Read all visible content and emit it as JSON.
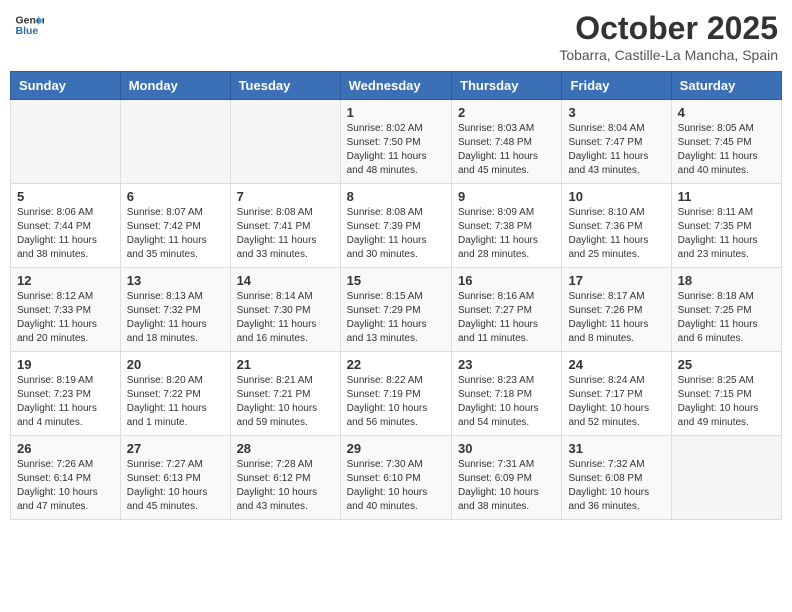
{
  "header": {
    "logo_general": "General",
    "logo_blue": "Blue",
    "month": "October 2025",
    "location": "Tobarra, Castille-La Mancha, Spain"
  },
  "weekdays": [
    "Sunday",
    "Monday",
    "Tuesday",
    "Wednesday",
    "Thursday",
    "Friday",
    "Saturday"
  ],
  "weeks": [
    [
      {
        "day": "",
        "sunrise": "",
        "sunset": "",
        "daylight": ""
      },
      {
        "day": "",
        "sunrise": "",
        "sunset": "",
        "daylight": ""
      },
      {
        "day": "",
        "sunrise": "",
        "sunset": "",
        "daylight": ""
      },
      {
        "day": "1",
        "sunrise": "Sunrise: 8:02 AM",
        "sunset": "Sunset: 7:50 PM",
        "daylight": "Daylight: 11 hours and 48 minutes."
      },
      {
        "day": "2",
        "sunrise": "Sunrise: 8:03 AM",
        "sunset": "Sunset: 7:48 PM",
        "daylight": "Daylight: 11 hours and 45 minutes."
      },
      {
        "day": "3",
        "sunrise": "Sunrise: 8:04 AM",
        "sunset": "Sunset: 7:47 PM",
        "daylight": "Daylight: 11 hours and 43 minutes."
      },
      {
        "day": "4",
        "sunrise": "Sunrise: 8:05 AM",
        "sunset": "Sunset: 7:45 PM",
        "daylight": "Daylight: 11 hours and 40 minutes."
      }
    ],
    [
      {
        "day": "5",
        "sunrise": "Sunrise: 8:06 AM",
        "sunset": "Sunset: 7:44 PM",
        "daylight": "Daylight: 11 hours and 38 minutes."
      },
      {
        "day": "6",
        "sunrise": "Sunrise: 8:07 AM",
        "sunset": "Sunset: 7:42 PM",
        "daylight": "Daylight: 11 hours and 35 minutes."
      },
      {
        "day": "7",
        "sunrise": "Sunrise: 8:08 AM",
        "sunset": "Sunset: 7:41 PM",
        "daylight": "Daylight: 11 hours and 33 minutes."
      },
      {
        "day": "8",
        "sunrise": "Sunrise: 8:08 AM",
        "sunset": "Sunset: 7:39 PM",
        "daylight": "Daylight: 11 hours and 30 minutes."
      },
      {
        "day": "9",
        "sunrise": "Sunrise: 8:09 AM",
        "sunset": "Sunset: 7:38 PM",
        "daylight": "Daylight: 11 hours and 28 minutes."
      },
      {
        "day": "10",
        "sunrise": "Sunrise: 8:10 AM",
        "sunset": "Sunset: 7:36 PM",
        "daylight": "Daylight: 11 hours and 25 minutes."
      },
      {
        "day": "11",
        "sunrise": "Sunrise: 8:11 AM",
        "sunset": "Sunset: 7:35 PM",
        "daylight": "Daylight: 11 hours and 23 minutes."
      }
    ],
    [
      {
        "day": "12",
        "sunrise": "Sunrise: 8:12 AM",
        "sunset": "Sunset: 7:33 PM",
        "daylight": "Daylight: 11 hours and 20 minutes."
      },
      {
        "day": "13",
        "sunrise": "Sunrise: 8:13 AM",
        "sunset": "Sunset: 7:32 PM",
        "daylight": "Daylight: 11 hours and 18 minutes."
      },
      {
        "day": "14",
        "sunrise": "Sunrise: 8:14 AM",
        "sunset": "Sunset: 7:30 PM",
        "daylight": "Daylight: 11 hours and 16 minutes."
      },
      {
        "day": "15",
        "sunrise": "Sunrise: 8:15 AM",
        "sunset": "Sunset: 7:29 PM",
        "daylight": "Daylight: 11 hours and 13 minutes."
      },
      {
        "day": "16",
        "sunrise": "Sunrise: 8:16 AM",
        "sunset": "Sunset: 7:27 PM",
        "daylight": "Daylight: 11 hours and 11 minutes."
      },
      {
        "day": "17",
        "sunrise": "Sunrise: 8:17 AM",
        "sunset": "Sunset: 7:26 PM",
        "daylight": "Daylight: 11 hours and 8 minutes."
      },
      {
        "day": "18",
        "sunrise": "Sunrise: 8:18 AM",
        "sunset": "Sunset: 7:25 PM",
        "daylight": "Daylight: 11 hours and 6 minutes."
      }
    ],
    [
      {
        "day": "19",
        "sunrise": "Sunrise: 8:19 AM",
        "sunset": "Sunset: 7:23 PM",
        "daylight": "Daylight: 11 hours and 4 minutes."
      },
      {
        "day": "20",
        "sunrise": "Sunrise: 8:20 AM",
        "sunset": "Sunset: 7:22 PM",
        "daylight": "Daylight: 11 hours and 1 minute."
      },
      {
        "day": "21",
        "sunrise": "Sunrise: 8:21 AM",
        "sunset": "Sunset: 7:21 PM",
        "daylight": "Daylight: 10 hours and 59 minutes."
      },
      {
        "day": "22",
        "sunrise": "Sunrise: 8:22 AM",
        "sunset": "Sunset: 7:19 PM",
        "daylight": "Daylight: 10 hours and 56 minutes."
      },
      {
        "day": "23",
        "sunrise": "Sunrise: 8:23 AM",
        "sunset": "Sunset: 7:18 PM",
        "daylight": "Daylight: 10 hours and 54 minutes."
      },
      {
        "day": "24",
        "sunrise": "Sunrise: 8:24 AM",
        "sunset": "Sunset: 7:17 PM",
        "daylight": "Daylight: 10 hours and 52 minutes."
      },
      {
        "day": "25",
        "sunrise": "Sunrise: 8:25 AM",
        "sunset": "Sunset: 7:15 PM",
        "daylight": "Daylight: 10 hours and 49 minutes."
      }
    ],
    [
      {
        "day": "26",
        "sunrise": "Sunrise: 7:26 AM",
        "sunset": "Sunset: 6:14 PM",
        "daylight": "Daylight: 10 hours and 47 minutes."
      },
      {
        "day": "27",
        "sunrise": "Sunrise: 7:27 AM",
        "sunset": "Sunset: 6:13 PM",
        "daylight": "Daylight: 10 hours and 45 minutes."
      },
      {
        "day": "28",
        "sunrise": "Sunrise: 7:28 AM",
        "sunset": "Sunset: 6:12 PM",
        "daylight": "Daylight: 10 hours and 43 minutes."
      },
      {
        "day": "29",
        "sunrise": "Sunrise: 7:30 AM",
        "sunset": "Sunset: 6:10 PM",
        "daylight": "Daylight: 10 hours and 40 minutes."
      },
      {
        "day": "30",
        "sunrise": "Sunrise: 7:31 AM",
        "sunset": "Sunset: 6:09 PM",
        "daylight": "Daylight: 10 hours and 38 minutes."
      },
      {
        "day": "31",
        "sunrise": "Sunrise: 7:32 AM",
        "sunset": "Sunset: 6:08 PM",
        "daylight": "Daylight: 10 hours and 36 minutes."
      },
      {
        "day": "",
        "sunrise": "",
        "sunset": "",
        "daylight": ""
      }
    ]
  ]
}
